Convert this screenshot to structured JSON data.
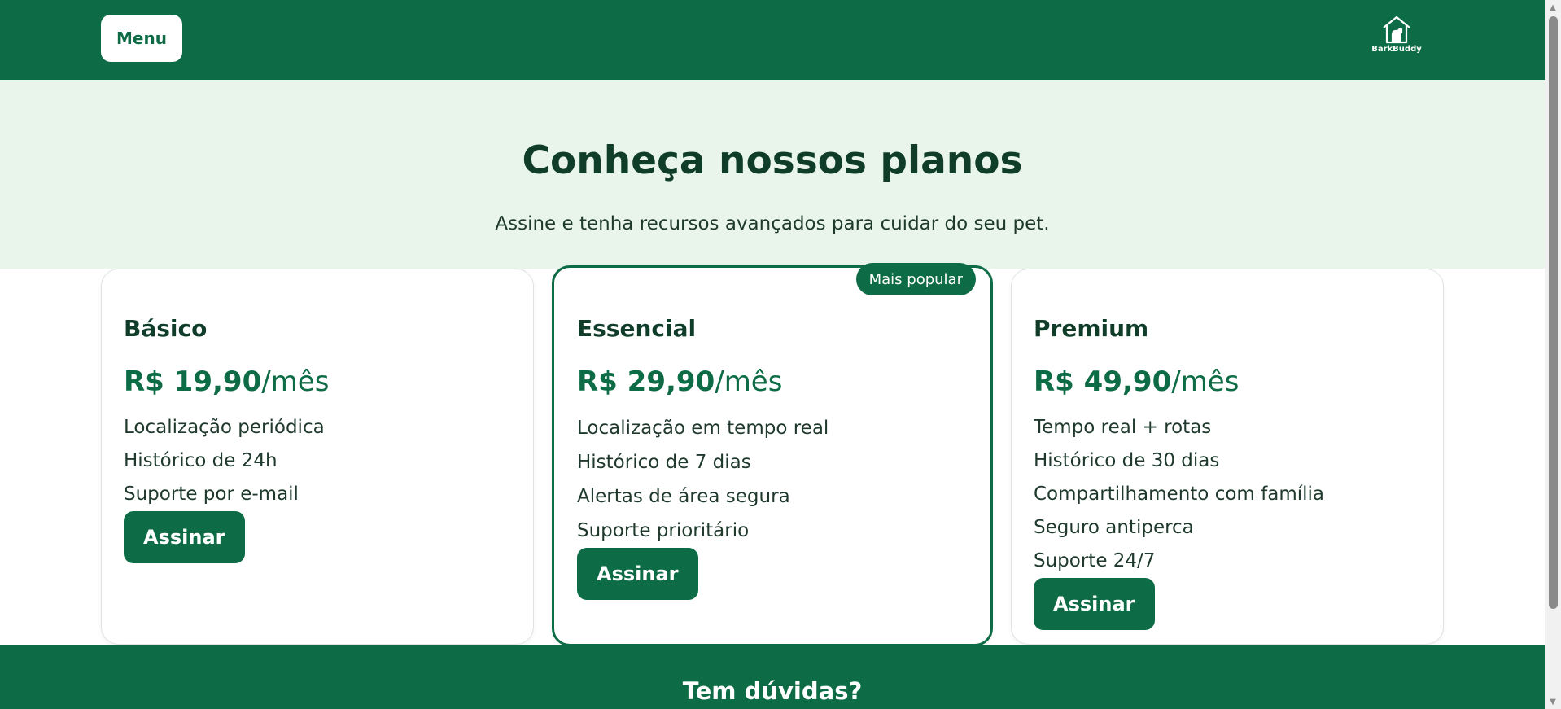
{
  "header": {
    "menu_label": "Menu",
    "logo_text": "BarkBuddy",
    "background_color": "#0d6c45"
  },
  "hero": {
    "title": "Conheça nossos planos",
    "subtitle": "Assine e tenha recursos avançados para cuidar do seu pet.",
    "background_color": "#e9f5ea"
  },
  "plans": [
    {
      "name": "Básico",
      "price": "R$ 19,90",
      "period": "/mês",
      "features": [
        "Localização periódica",
        "Histórico de 24h",
        "Suporte por e-mail"
      ],
      "button_label": "Assinar"
    },
    {
      "name": "Essencial",
      "price": "R$ 29,90",
      "period": "/mês",
      "badge": "Mais popular",
      "features": [
        "Localização em tempo real",
        "Histórico de 7 dias",
        "Alertas de área segura",
        "Suporte prioritário"
      ],
      "button_label": "Assinar"
    },
    {
      "name": "Premium",
      "price": "R$ 49,90",
      "period": "/mês",
      "features": [
        "Tempo real + rotas",
        "Histórico de 30 dias",
        "Compartilhamento com família",
        "Seguro antiperca",
        "Suporte 24/7"
      ],
      "button_label": "Assinar"
    }
  ],
  "faq": {
    "title": "Tem dúvidas?"
  },
  "icons": {
    "logo": "dog-house-icon",
    "scroll_up": "arrow-up-icon",
    "scroll_down": "arrow-down-icon"
  },
  "colors": {
    "brand": "#0d6c45",
    "text_dark": "#0f3d2a"
  }
}
